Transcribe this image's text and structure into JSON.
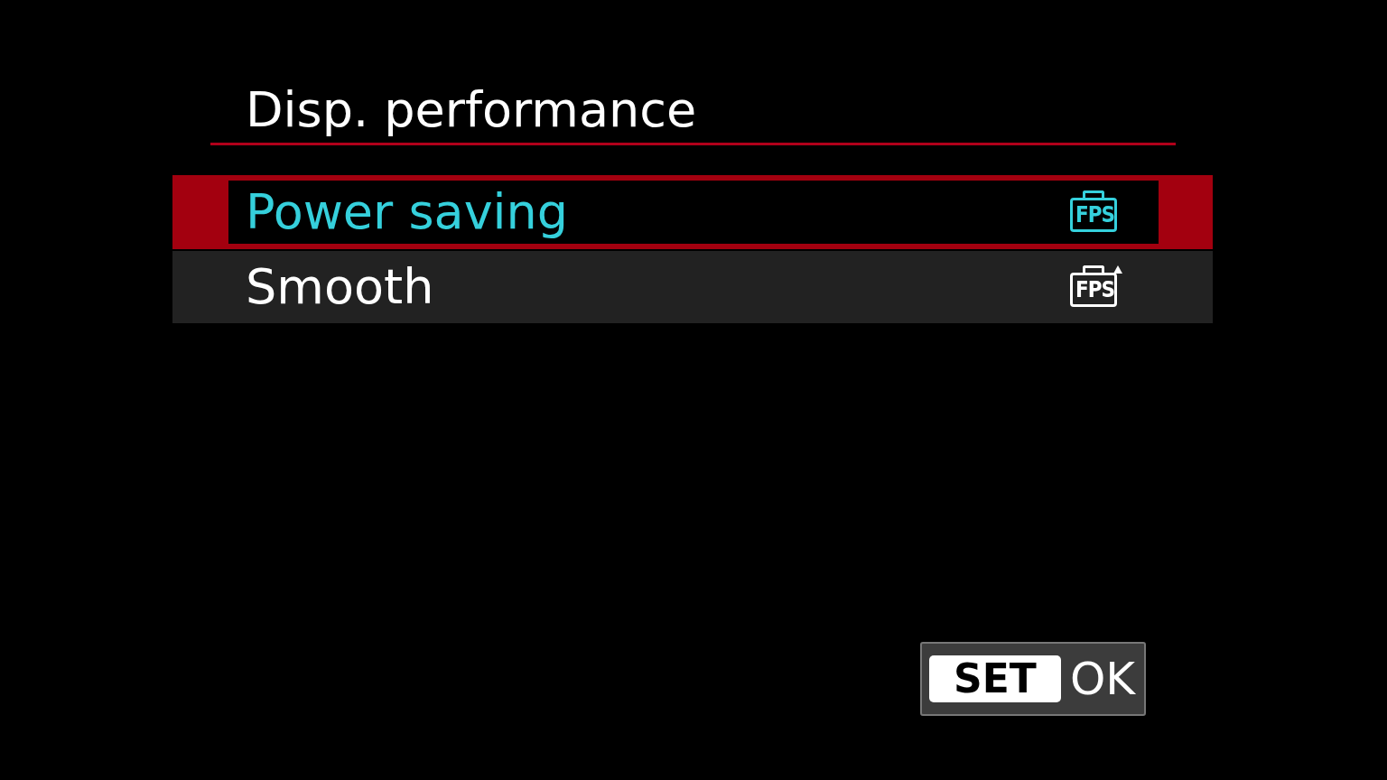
{
  "title": "Disp. performance",
  "options": [
    {
      "label": "Power saving",
      "selected": true,
      "kind": "fps",
      "icon_text": "FPS"
    },
    {
      "label": "Smooth",
      "selected": false,
      "kind": "fps_up",
      "icon_text": "FPS"
    }
  ],
  "hint": {
    "key": "SET",
    "action": "OK"
  }
}
